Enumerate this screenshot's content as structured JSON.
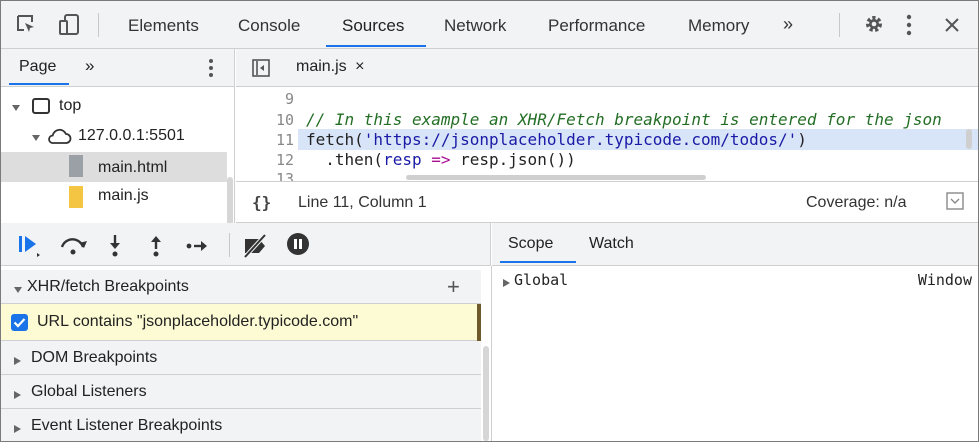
{
  "tabs": [
    {
      "label": "Elements"
    },
    {
      "label": "Console"
    },
    {
      "label": "Sources"
    },
    {
      "label": "Network"
    },
    {
      "label": "Performance"
    },
    {
      "label": "Memory"
    }
  ],
  "more_tabs": "»",
  "accent_color": "#1a73e8",
  "navigator": {
    "tab": "Page",
    "more": "»",
    "tree": [
      {
        "label": "top"
      },
      {
        "label": "127.0.0.1:5501"
      },
      {
        "label": "main.html"
      },
      {
        "label": "main.js"
      }
    ]
  },
  "editor": {
    "file_tab": "main.js",
    "close": "×",
    "lines": [
      {
        "n": "9"
      },
      {
        "n": "10",
        "comment": "// In this example an XHR/Fetch breakpoint is entered for the json"
      },
      {
        "n": "11",
        "fn": "fetch(",
        "str": "'https://jsonplaceholder.typicode.com/todos/'",
        "end": ")"
      },
      {
        "n": "12",
        "pre": "  .then(",
        "arg": "resp",
        "arrow": " => ",
        "tail": "resp.json())"
      },
      {
        "n": "13"
      }
    ],
    "braces": "{}",
    "position": "Line 11, Column 1",
    "coverage": "Coverage: n/a"
  },
  "breakpoints": {
    "xhr_title": "XHR/fetch Breakpoints",
    "add": "+",
    "xhr_item": "URL contains \"jsonplaceholder.typicode.com\"",
    "xhr_checked": true,
    "sections": [
      "DOM Breakpoints",
      "Global Listeners",
      "Event Listener Breakpoints"
    ]
  },
  "scope": {
    "tabs": [
      "Scope",
      "Watch"
    ],
    "global_label": "Global",
    "global_value": "Window"
  }
}
